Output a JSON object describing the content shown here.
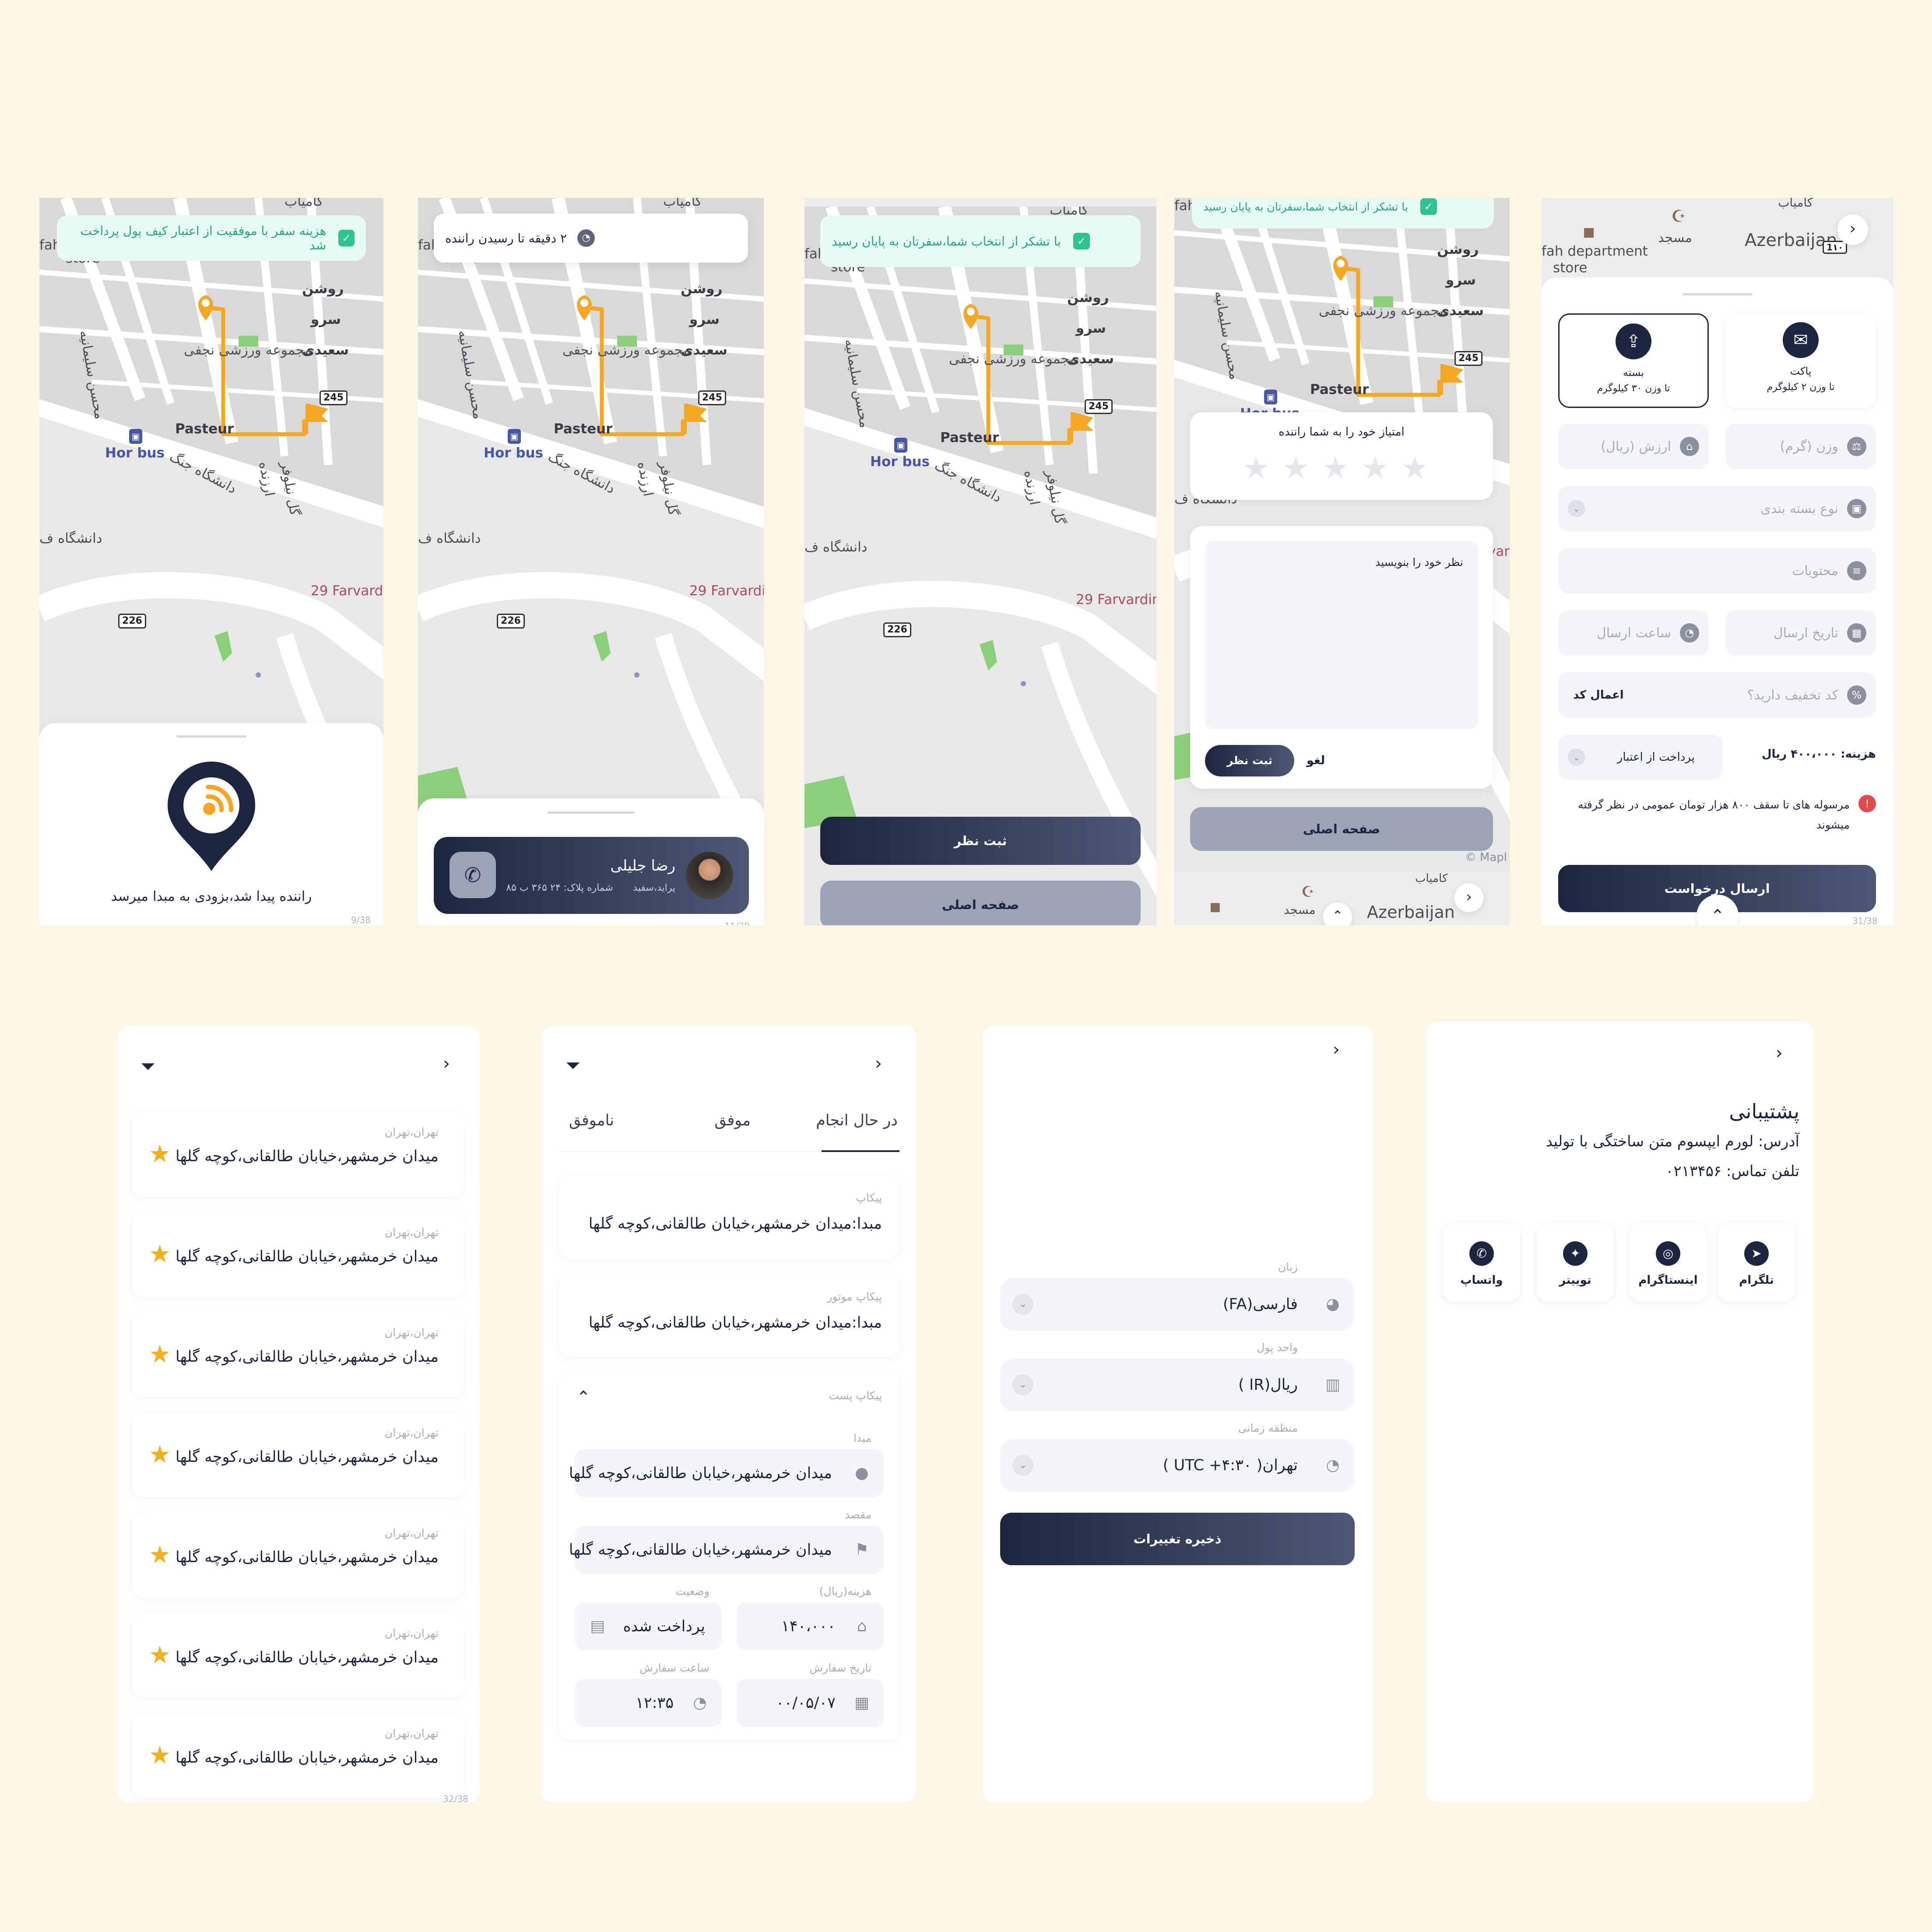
{
  "screens": {
    "s1": {
      "toast": "هزینه سفر با موفقیت از اعتبار کیف پول پرداخت شد",
      "message": "راننده پیدا شد،بزودی به مبدا میرسد",
      "page": "9/38"
    },
    "s2": {
      "eta": "۲ دقیقه تا رسیدن راننده",
      "driver_name": "رضا جلیلی",
      "car": "پراید،سفید",
      "plate": "شماره پلاک: ۲۴ ۳۶۵ ب ۸۵",
      "page": "11/38"
    },
    "s3": {
      "toast": "با تشکر از انتخاب شما،سفرتان به پایان رسید",
      "submit_label": "ثبت نظر",
      "home_label": "صفحه اصلی"
    },
    "s4": {
      "toast": "با تشکر از انتخاب شما،سفرتان به پایان رسید",
      "rate_title": "امتیاز خود را به شما راننده",
      "comment_placeholder": "نظر خود را بنویسید",
      "submit_label": "ثبت نظر",
      "cancel_label": "لغو",
      "home_label": "صفحه اصلی",
      "attribution": "© Mapl"
    },
    "s5": {
      "type_box": {
        "title": "بسته",
        "sub": "تا وزن ۳۰ کیلوگرم"
      },
      "type_pack": {
        "title": "پاکت",
        "sub": "تا وزن ۲ کیلوگرم"
      },
      "weight_ph": "وزن (گرم)",
      "value_ph": "ارزش (ریال)",
      "packaging_ph": "نوع بسته بندی",
      "contents_ph": "محتویات",
      "date_ph": "تاریخ ارسال",
      "time_ph": "ساعت ارسال",
      "discount_ph": "کد تخفیف دارید؟",
      "apply_label": "اعمال کد",
      "cost": "هزینه: ۴۰۰،۰۰۰ ریال",
      "pay_method": "پرداخت از اعتبار",
      "notice": "مرسوله های تا سقف ۸۰۰ هزار تومان عمومی در نظر گرفته میشوند",
      "send_label": "ارسال درخواست",
      "page": "31/38"
    },
    "s6": {
      "items": [
        {
          "city": "تهران،تهران",
          "address": "میدان خرمشهر،خیابان طالقانی،کوچه گلها"
        },
        {
          "city": "تهران،تهران",
          "address": "میدان خرمشهر،خیابان طالقانی،کوچه گلها"
        },
        {
          "city": "تهران،تهران",
          "address": "میدان خرمشهر،خیابان طالقانی،کوچه گلها"
        },
        {
          "city": "تهران،تهران",
          "address": "میدان خرمشهر،خیابان طالقانی،کوچه گلها"
        },
        {
          "city": "تهران،تهران",
          "address": "میدان خرمشهر،خیابان طالقانی،کوچه گلها"
        },
        {
          "city": "تهران،تهران",
          "address": "میدان خرمشهر،خیابان طالقانی،کوچه گلها"
        },
        {
          "city": "تهران،تهران",
          "address": "میدان خرمشهر،خیابان طالقانی،کوچه گلها"
        }
      ],
      "page": "32/38"
    },
    "s7": {
      "tabs": [
        "در حال انجام",
        "موفق",
        "ناموفق"
      ],
      "order1": {
        "type": "پیکاپ",
        "address": "مبدا:میدان خرمشهر،خیابان طالقانی،کوچه گلها"
      },
      "order2": {
        "type": "پیکاپ موتور",
        "address": "مبدا:میدان خرمشهر،خیابان طالقانی،کوچه گلها"
      },
      "order3": {
        "type": "پیکاپ پست",
        "origin_label": "مبدا",
        "origin": "میدان خرمشهر،خیابان طالقانی،کوچه گلها",
        "dest_label": "مقصد",
        "dest": "میدان خرمشهر،خیابان طالقانی،کوچه گلها",
        "cost_label": "هزینه(ریال)",
        "cost": "۱۴۰،۰۰۰",
        "status_label": "وضعیت",
        "status": "پرداخت شده",
        "date_label": "تاریخ سفارش",
        "date": "۰۰/۰۵/۰۷",
        "time_label": "ساعت سفارش",
        "time": "۱۲:۳۵"
      }
    },
    "s8": {
      "lang_label": "زبان",
      "lang": "فارسی(FA)",
      "currency_label": "واحد پول",
      "currency": "ریال(IR )",
      "tz_label": "منطقه زمانی",
      "tz": "تهران( UTC +۴:۳۰ )",
      "save_label": "ذخیره تغییرات"
    },
    "s9": {
      "title": "پشتیبانی",
      "address": "آدرس: لورم ایپسوم متن ساختگی با تولید",
      "phone": "تلفن تماس: ۰۲۱۳۴۵۶",
      "socials": [
        "تلگرام",
        "اینستاگرام",
        "توییتر",
        "واتساپ"
      ]
    }
  },
  "map_labels": {
    "rowshan": "روشن",
    "sarv": "سرو",
    "saeedi": "سعیدی",
    "mohsen": "محسن سلیمانیه",
    "majmooe": "مجموعه ورزشی نجفی",
    "pasteur": "Pasteur",
    "horbus": "Hor bus",
    "daneshgah_jang": "دانشگاه جنگ",
    "arzandeh": "ارزنده",
    "gol_niloufar": "گل نیلوفر",
    "daneshgah": "دانشگاه ف",
    "farvardin": "29 Farvardin",
    "store": "store",
    "fah": "fah",
    "kamyab": "کامیاب",
    "shield_245": "245",
    "shield_226": "226",
    "azerbaijan": "Azerbaijan",
    "masjed": "مسجد",
    "fah_dept": "fah department",
    "shield_110": "1۱۰"
  },
  "colors": {
    "primary": "#1d2640",
    "accent": "#f5a623",
    "success": "#2ec191",
    "background": "#fdf6e7",
    "star": "#f2b01e"
  }
}
